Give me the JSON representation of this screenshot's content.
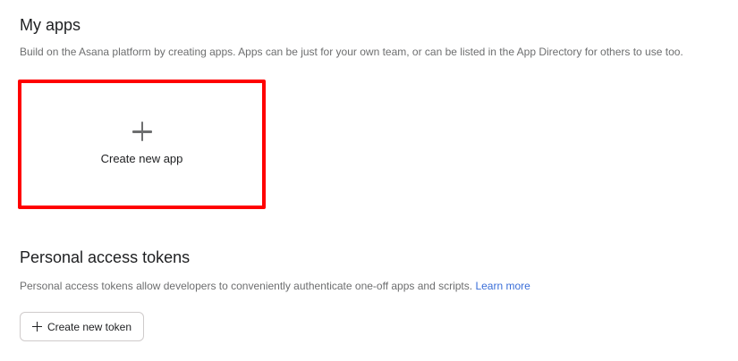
{
  "my_apps": {
    "title": "My apps",
    "description": "Build on the Asana platform by creating apps. Apps can be just for your own team, or can be listed in the App Directory for others to use too.",
    "create_card": {
      "icon": "plus-icon",
      "label": "Create new app",
      "highlight_color": "#ff0000"
    }
  },
  "tokens": {
    "title": "Personal access tokens",
    "description": "Personal access tokens allow developers to conveniently authenticate one-off apps and scripts.",
    "learn_more": "Learn more",
    "create_button": {
      "icon": "plus-icon",
      "label": "Create new token"
    }
  },
  "colors": {
    "link": "#3a6ed8",
    "muted_text": "#6d6e6f",
    "text": "#1e1f21"
  }
}
